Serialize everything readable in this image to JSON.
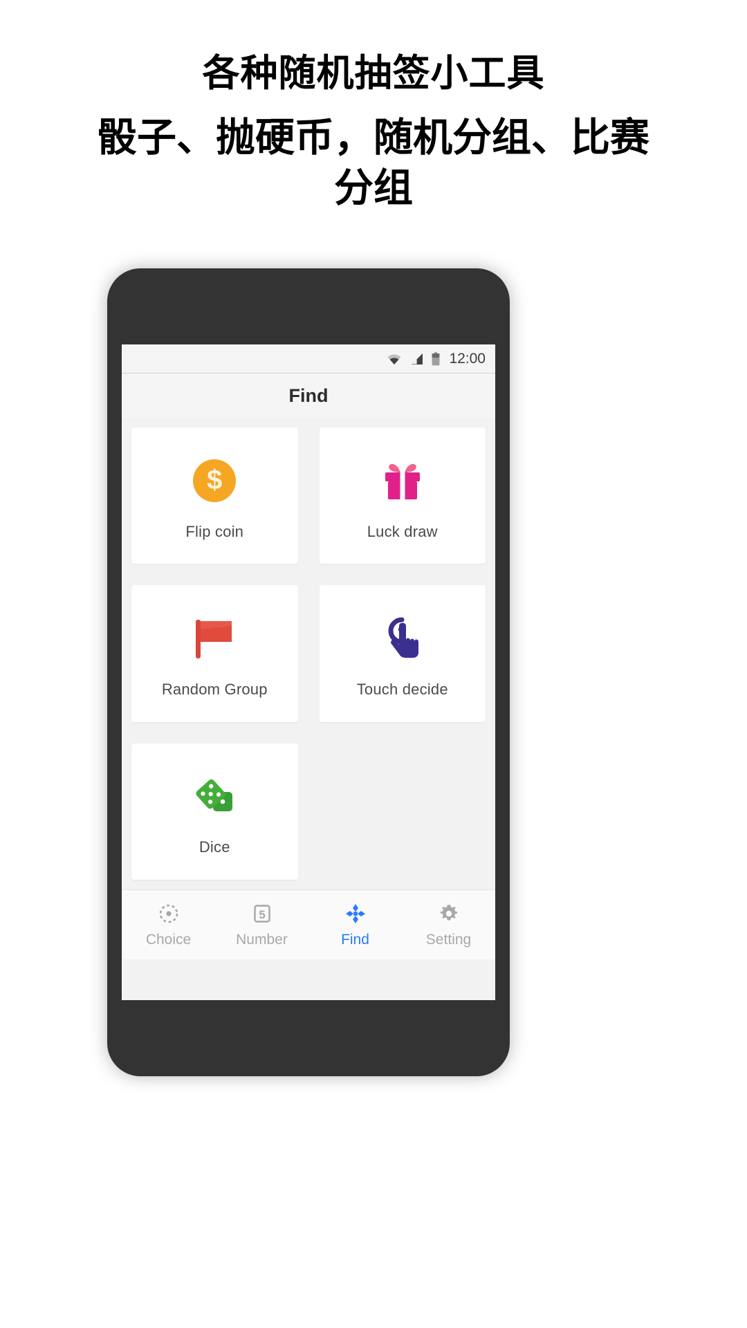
{
  "promo": {
    "headline": "各种随机抽签小工具",
    "subheadline": "骰子、抛硬币，随机分组、比赛分组"
  },
  "phone": {
    "statusbar": {
      "time": "12:00",
      "icons": [
        "wifi-icon",
        "cellular-signal-icon",
        "battery-icon"
      ]
    },
    "titlebar": {
      "title": "Find"
    },
    "grid": {
      "cards": [
        {
          "label": "Flip coin",
          "icon": "coin-dollar-icon",
          "color": "#F5A623"
        },
        {
          "label": "Luck draw",
          "icon": "gift-icon",
          "color": "#E91E78"
        },
        {
          "label": "Random Group",
          "icon": "flag-icon",
          "color": "#E04B3C"
        },
        {
          "label": "Touch decide",
          "icon": "tap-hand-icon",
          "color": "#3B2F8F"
        },
        {
          "label": "Dice",
          "icon": "dice-icon",
          "color": "#39A037"
        },
        {
          "label": "",
          "icon": "",
          "color": ""
        }
      ]
    },
    "bottomnav": {
      "active_color": "#2979FF",
      "inactive_color": "#a8a8a8",
      "items": [
        {
          "label": "Choice",
          "icon": "target-dashed-circle-icon",
          "active": false
        },
        {
          "label": "Number",
          "icon": "number-five-box-icon",
          "active": false
        },
        {
          "label": "Find",
          "icon": "compass-petals-icon",
          "active": true
        },
        {
          "label": "Setting",
          "icon": "gear-icon",
          "active": false
        }
      ]
    }
  }
}
